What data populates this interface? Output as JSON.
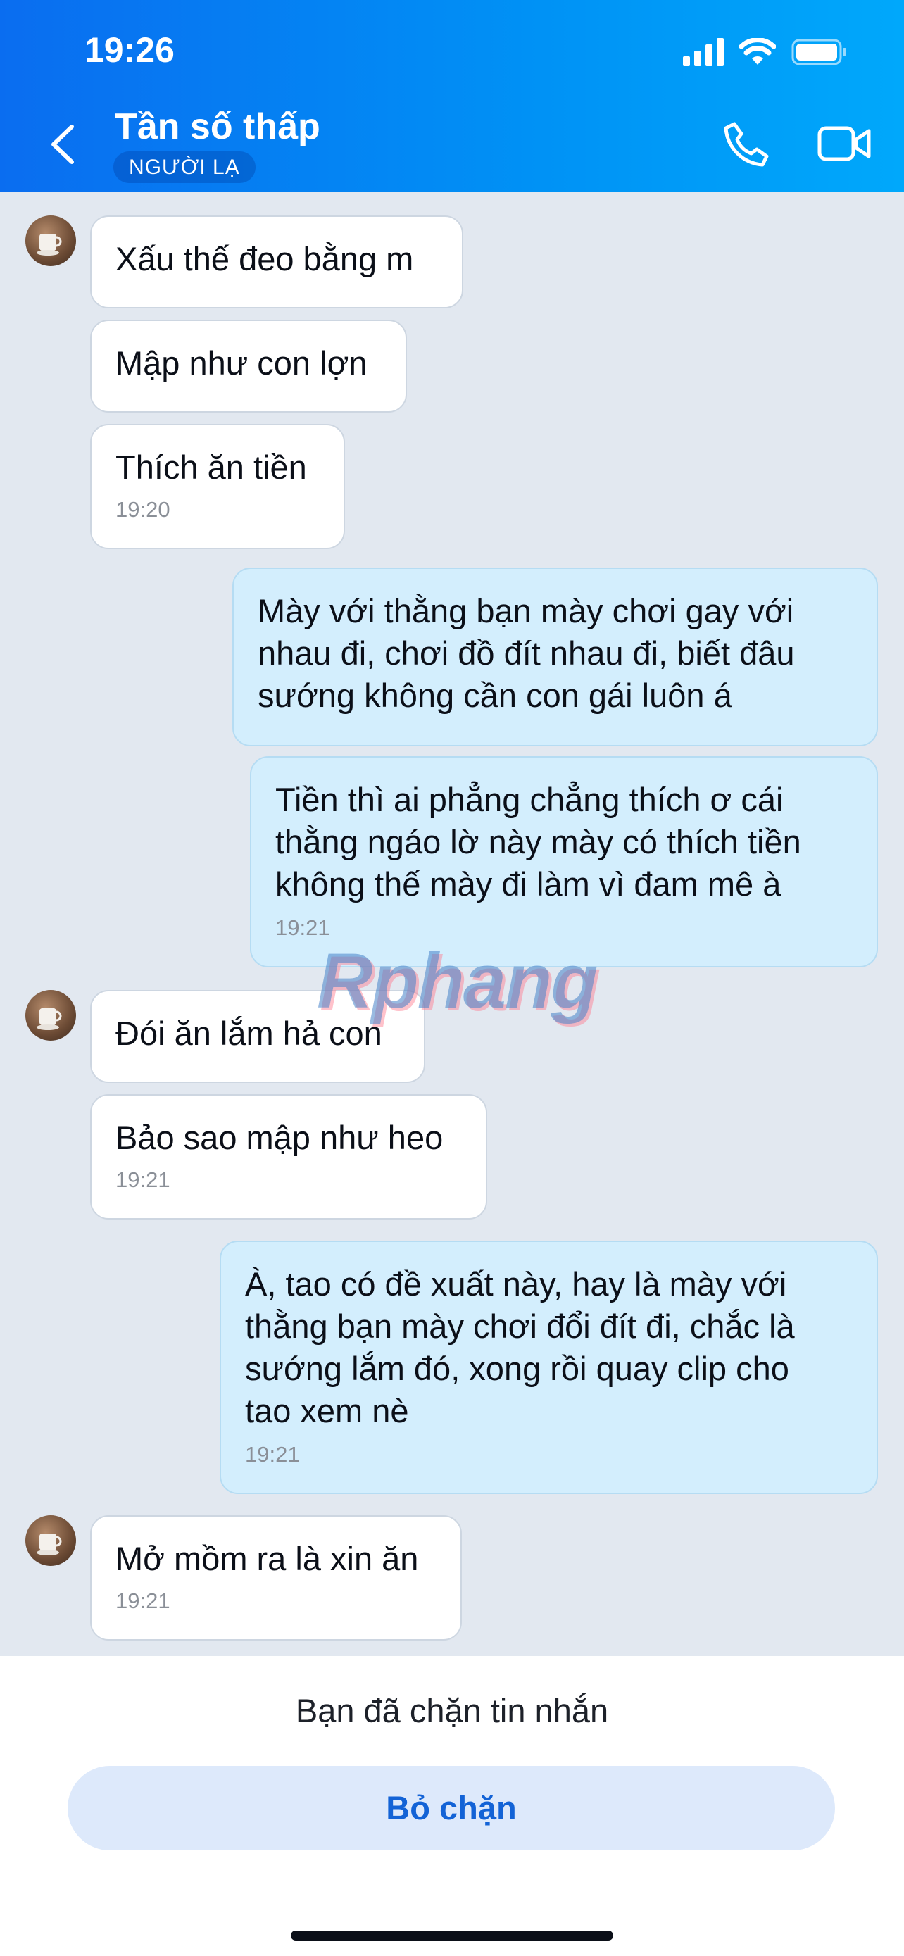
{
  "status_bar": {
    "time": "19:26"
  },
  "header": {
    "title": "Tần số thấp",
    "badge": "NGƯỜI LẠ",
    "icons": [
      "back-icon",
      "phone-icon",
      "video-call-icon"
    ]
  },
  "messages": [
    {
      "dir": "in",
      "text": "Xấu thế đeo bằng m",
      "time": ""
    },
    {
      "dir": "in",
      "text": "Mập như con lợn",
      "time": ""
    },
    {
      "dir": "in",
      "text": "Thích ăn tiền",
      "time": "19:20"
    },
    {
      "dir": "out",
      "text": "Mày với thằng bạn mày chơi gay với\nnhau đi, chơi đồ đít nhau đi, biết đâu\nsướng không cần con gái luôn á",
      "time": ""
    },
    {
      "dir": "out",
      "text": "Tiền thì ai phẳng chẳng thích ơ cái\nthằng ngáo lờ này mày có thích tiền\nkhông thế mày đi làm vì đam mê à",
      "time": "19:21"
    },
    {
      "dir": "in",
      "text": "Đói ăn lắm hả con",
      "time": ""
    },
    {
      "dir": "in",
      "text": "Bảo sao mập như heo",
      "time": "19:21"
    },
    {
      "dir": "out",
      "text": "À, tao có đề xuất này, hay là mày với\nthằng bạn mày chơi đổi đít đi, chắc là\nsướng lắm đó, xong rồi quay clip cho\ntao xem nè",
      "time": "19:21"
    },
    {
      "dir": "in",
      "text": "Mở mồm ra là xin ăn",
      "time": "19:21"
    }
  ],
  "watermark": "Rphang",
  "footer": {
    "blocked_text": "Bạn đã chặn tin nhắn",
    "unblock_label": "Bỏ chặn"
  }
}
